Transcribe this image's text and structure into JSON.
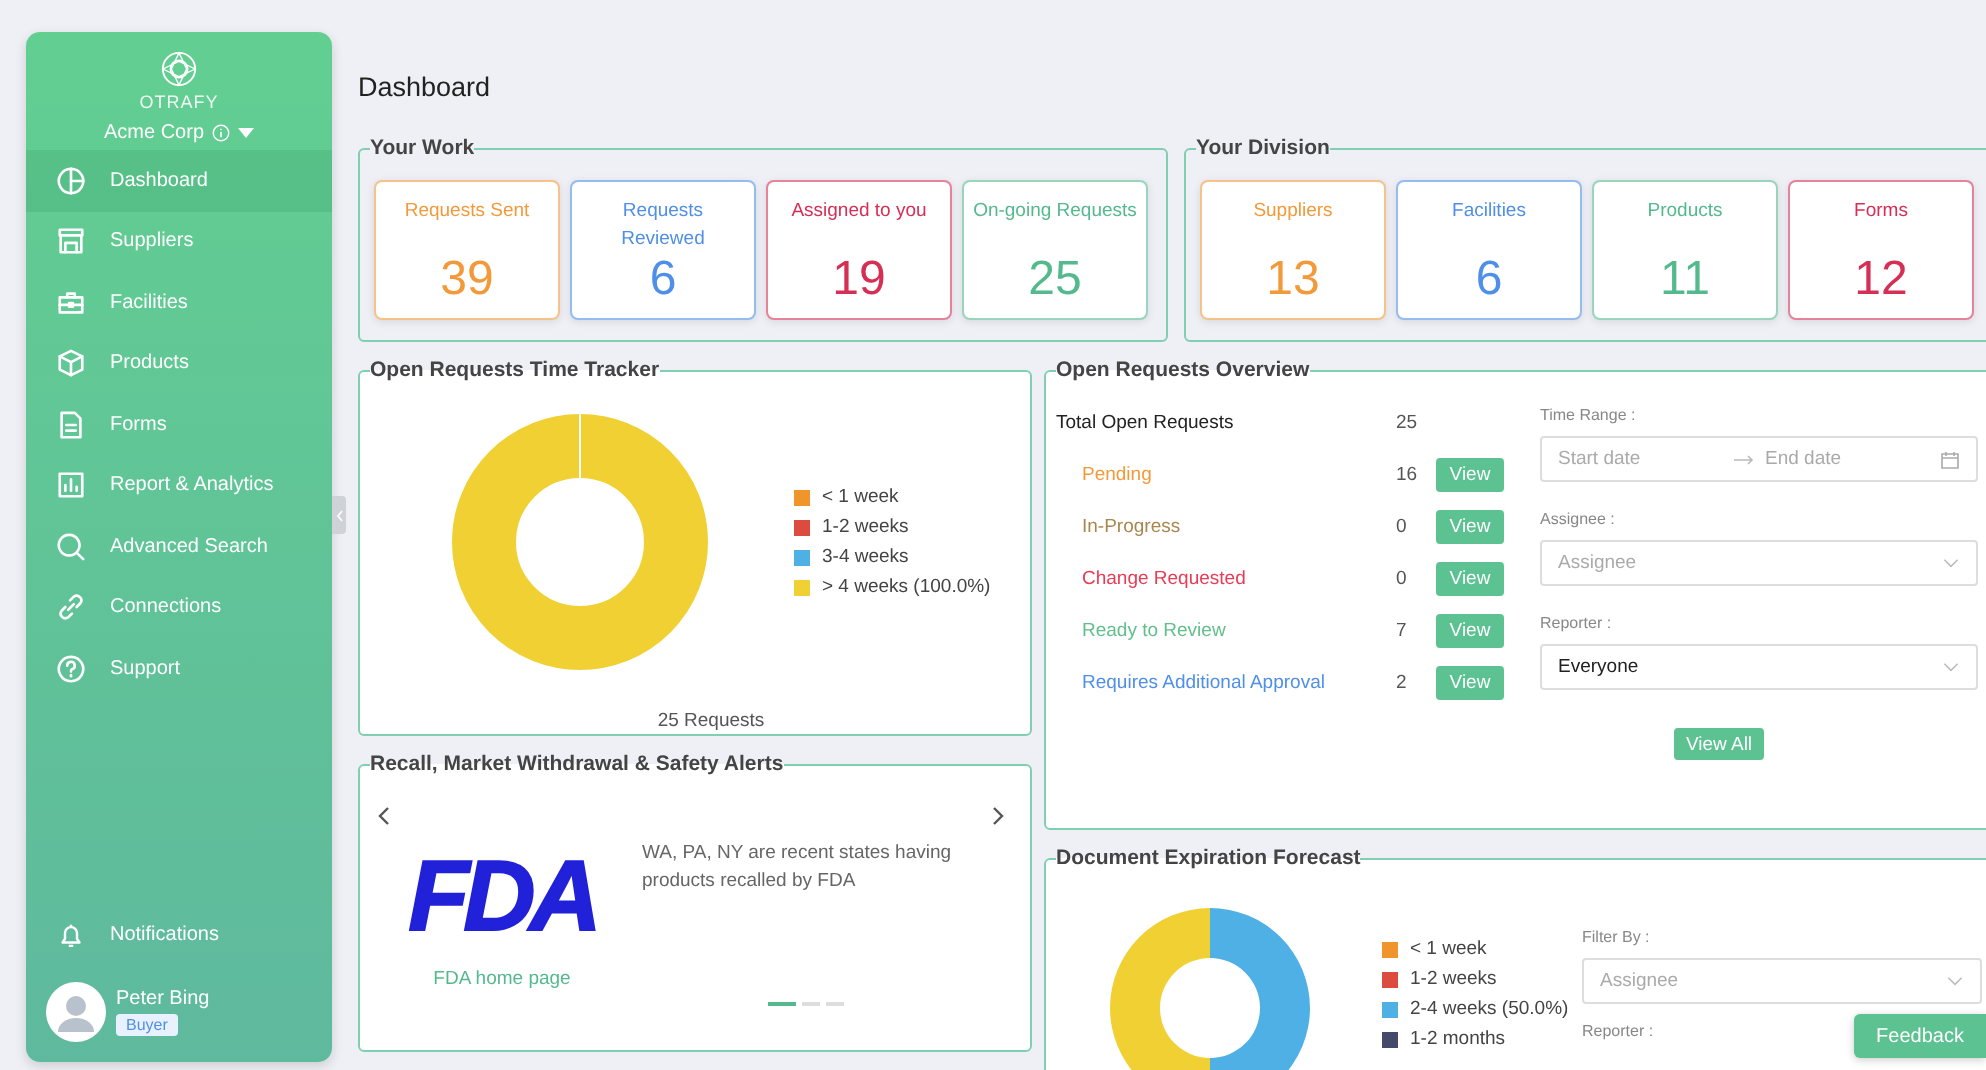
{
  "sidebar": {
    "logo_text": "OTRAFY",
    "org": "Acme Corp",
    "nav": [
      {
        "label": "Dashboard",
        "selected": true
      },
      {
        "label": "Suppliers",
        "selected": false
      },
      {
        "label": "Facilities",
        "selected": false
      },
      {
        "label": "Products",
        "selected": false
      },
      {
        "label": "Forms",
        "selected": false
      },
      {
        "label": "Report & Analytics",
        "selected": false
      },
      {
        "label": "Advanced Search",
        "selected": false
      },
      {
        "label": "Connections",
        "selected": false
      },
      {
        "label": "Support",
        "selected": false
      }
    ],
    "notifications": "Notifications",
    "user": {
      "name": "Peter Bing",
      "role": "Buyer"
    }
  },
  "page_title": "Dashboard",
  "your_work": {
    "title": "Your Work",
    "cards": [
      {
        "label": "Requests Sent",
        "value": "39",
        "color": "#f29a3a"
      },
      {
        "label": "Requests Reviewed",
        "value": "6",
        "color": "#4f8fe8"
      },
      {
        "label": "Assigned to you",
        "value": "19",
        "color": "#d62f55"
      },
      {
        "label": "On-going Requests",
        "value": "25",
        "color": "#55b98e"
      }
    ]
  },
  "your_division": {
    "title": "Your Division",
    "cards": [
      {
        "label": "Suppliers",
        "value": "13",
        "color": "#f29a3a"
      },
      {
        "label": "Facilities",
        "value": "6",
        "color": "#4f8fe8"
      },
      {
        "label": "Products",
        "value": "11",
        "color": "#55b98e"
      },
      {
        "label": "Forms",
        "value": "12",
        "color": "#d62f55"
      }
    ]
  },
  "time_tracker": {
    "title": "Open Requests Time Tracker",
    "legend": [
      {
        "label": "< 1 week",
        "color": "#f0952b"
      },
      {
        "label": "1-2 weeks",
        "color": "#dc4b3f"
      },
      {
        "label": "3-4 weeks",
        "color": "#4fb0e6"
      },
      {
        "label": "> 4 weeks (100.0%)",
        "color": "#f1d033"
      }
    ],
    "total": "25 Requests"
  },
  "overview": {
    "title": "Open Requests Overview",
    "total_label": "Total Open Requests",
    "total_value": "25",
    "statuses": [
      {
        "label": "Pending",
        "count": "16",
        "color": "#f29a3a",
        "button": "View"
      },
      {
        "label": "In-Progress",
        "count": "0",
        "color": "#a8874f",
        "button": "View"
      },
      {
        "label": "Change Requested",
        "count": "0",
        "color": "#e83b55",
        "button": "View"
      },
      {
        "label": "Ready to Review",
        "count": "7",
        "color": "#62bf8c",
        "button": "View"
      },
      {
        "label": "Requires Additional Approval",
        "count": "2",
        "color": "#4f8fe8",
        "button": "View"
      }
    ],
    "time_range": {
      "label": "Time Range :",
      "start_placeholder": "Start date",
      "end_placeholder": "End date"
    },
    "assignee": {
      "label": "Assignee :",
      "placeholder": "Assignee"
    },
    "reporter": {
      "label": "Reporter :",
      "value": "Everyone"
    },
    "view_all": "View All"
  },
  "alerts": {
    "title": "Recall, Market Withdrawal & Safety Alerts",
    "logo_text": "FDA",
    "link": "FDA home page",
    "text": "WA, PA, NY are recent states having products recalled by FDA",
    "dots": [
      {
        "selected": true
      },
      {
        "selected": false
      },
      {
        "selected": false
      }
    ]
  },
  "expiration": {
    "title": "Document Expiration Forecast",
    "legend": [
      {
        "label": "< 1 week",
        "color": "#f0952b"
      },
      {
        "label": "1-2 weeks",
        "color": "#dc4b3f"
      },
      {
        "label": "2-4 weeks (50.0%)",
        "color": "#4fb0e6"
      },
      {
        "label": "1-2 months",
        "color": "#454a6b"
      }
    ],
    "filter_label": "Filter By :",
    "assignee_placeholder": "Assignee",
    "reporter_label": "Reporter :"
  },
  "feedback": "Feedback"
}
